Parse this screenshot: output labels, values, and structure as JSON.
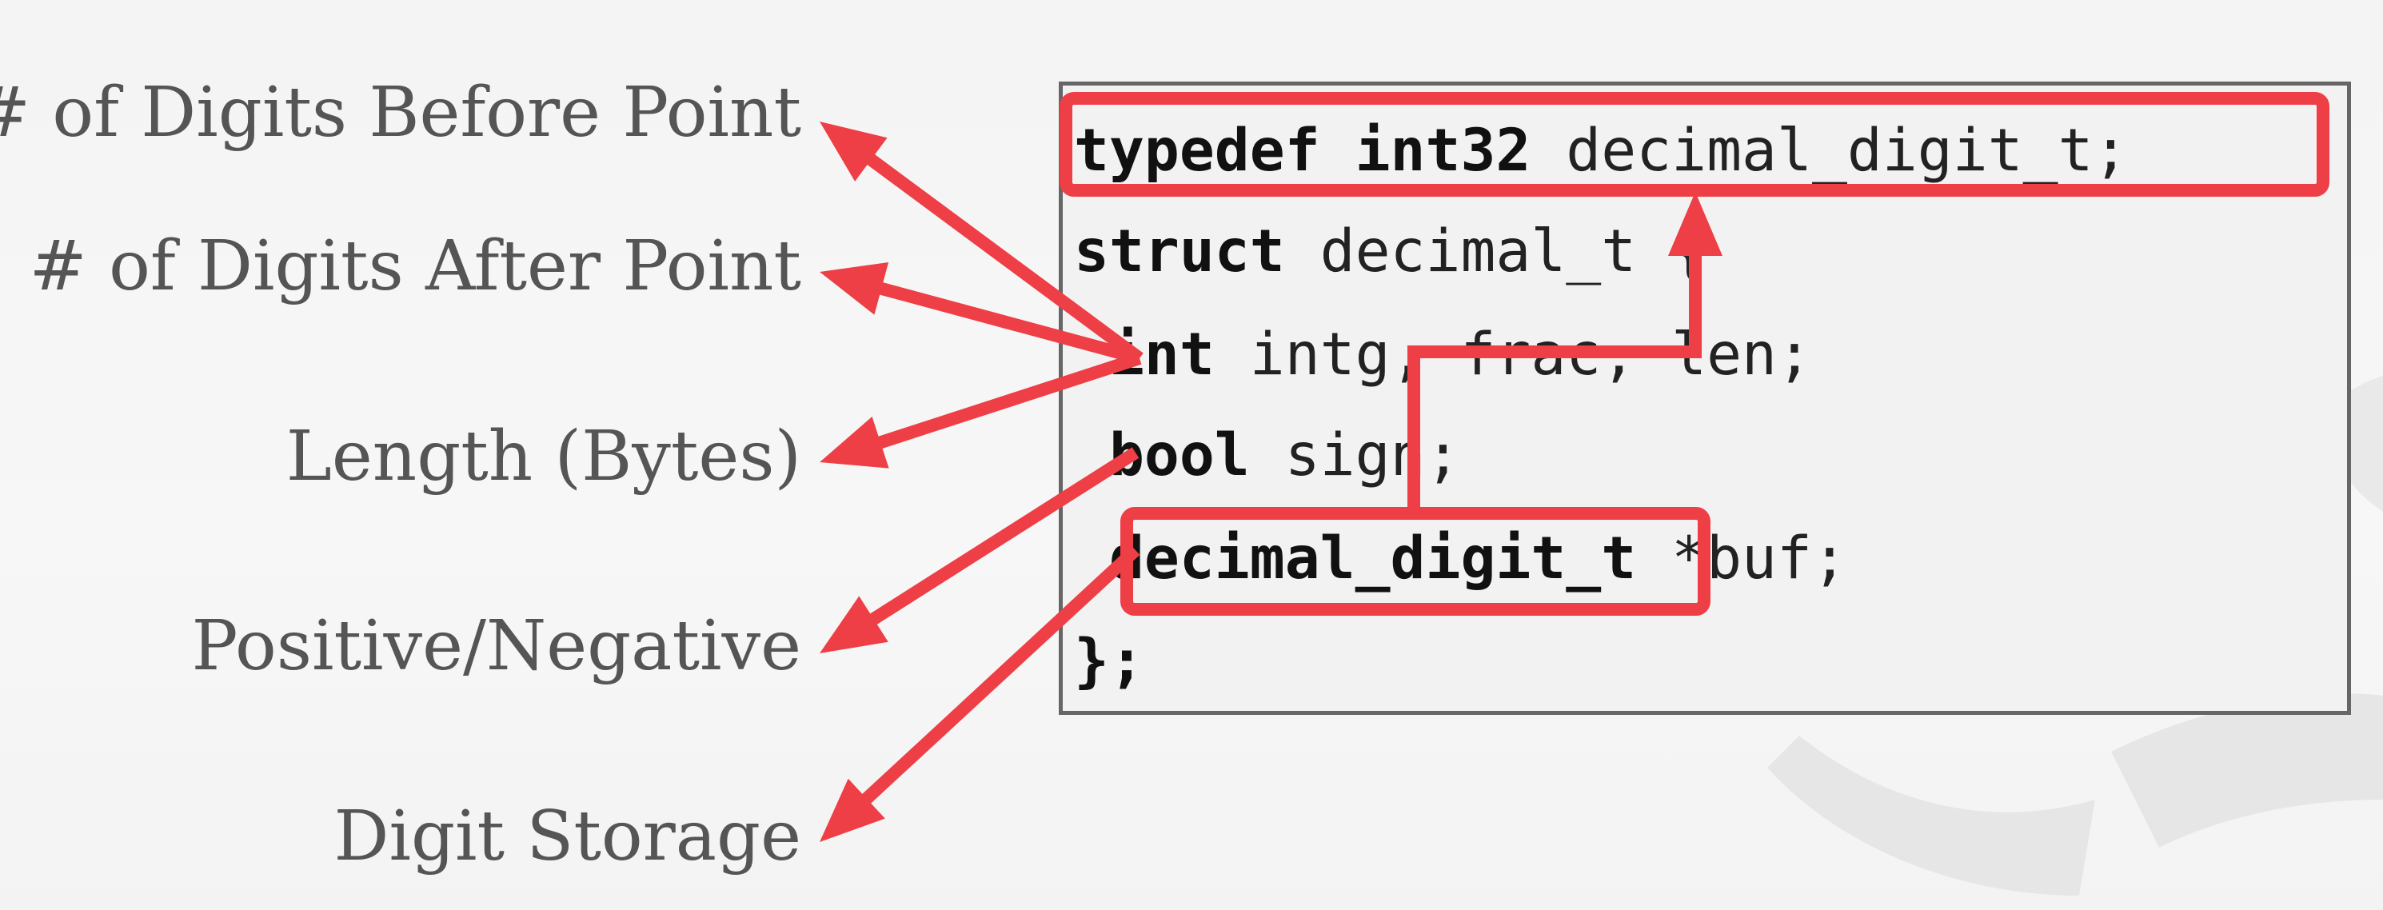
{
  "labels": {
    "digits_before": "# of Digits Before Point",
    "digits_after": "# of Digits After Point",
    "length": "Length (Bytes)",
    "sign": "Positive/Negative",
    "storage": "Digit Storage"
  },
  "code": {
    "line1": {
      "kw": "typedef int32",
      "rest": " decimal_digit_t;"
    },
    "line2": {
      "kw": "struct",
      "rest": " decimal_t {"
    },
    "line3": {
      "indent": " ",
      "kw": "int",
      "rest": " intg, frac, len;"
    },
    "line4": {
      "indent": " ",
      "kw": "bool",
      "rest": " sign;"
    },
    "line5": {
      "indent": " ",
      "kw": "decimal_digit_t",
      "rest": " *buf;"
    },
    "line6": {
      "kw": "};",
      "rest": ""
    }
  },
  "colors": {
    "highlight": "#ee3e46",
    "label_text": "#555555",
    "code_border": "#666666",
    "code_bg": "#f2f2f2"
  }
}
